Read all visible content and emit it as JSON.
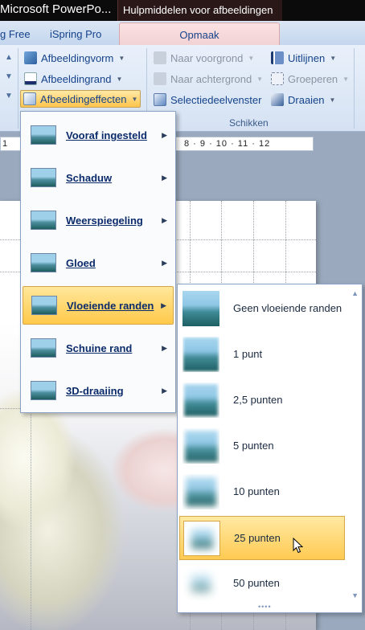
{
  "window": {
    "app_title": "Microsoft PowerPo...",
    "context_title": "Hulpmiddelen voor afbeeldingen"
  },
  "tabs": [
    {
      "label": "g Free"
    },
    {
      "label": "iSpring Pro"
    },
    {
      "label": "Opmaak",
      "active": true
    }
  ],
  "ribbon": {
    "picture_styles": [
      {
        "label": "Afbeeldingvorm",
        "icon": "shape-icon"
      },
      {
        "label": "Afbeeldingrand",
        "icon": "border-pen-icon"
      },
      {
        "label": "Afbeeldingeffecten",
        "icon": "effects-icon",
        "active": true
      }
    ],
    "arrange": [
      {
        "label": "Naar voorgrond",
        "icon": "bring-forward-icon",
        "disabled": true
      },
      {
        "label": "Naar achtergrond",
        "icon": "send-backward-icon",
        "disabled": true
      },
      {
        "label": "Selectiedeelvenster",
        "icon": "selection-pane-icon"
      },
      {
        "label": "Uitlijnen",
        "icon": "align-icon"
      },
      {
        "label": "Groeperen",
        "icon": "group-icon",
        "disabled": true
      },
      {
        "label": "Draaien",
        "icon": "rotate-icon"
      }
    ],
    "group_label": "Schikken"
  },
  "ruler": {
    "left_label": "1",
    "labels": "8 · 9 · 10 · 11 · 12"
  },
  "effects_menu": {
    "items": [
      {
        "label": "Vooraf ingesteld",
        "has_submenu": true
      },
      {
        "label": "Schaduw",
        "has_submenu": true
      },
      {
        "label": "Weerspiegeling",
        "has_submenu": true
      },
      {
        "label": "Gloed",
        "has_submenu": true
      },
      {
        "label": "Vloeiende randen",
        "has_submenu": true,
        "selected": true
      },
      {
        "label": "Schuine rand",
        "has_submenu": true
      },
      {
        "label": "3D-draaiing",
        "has_submenu": true
      }
    ]
  },
  "soft_edges_gallery": {
    "items": [
      {
        "label": "Geen vloeiende randen",
        "blur": 0
      },
      {
        "label": "1 punt",
        "blur": 1
      },
      {
        "label": "2,5 punten",
        "blur": 2.5
      },
      {
        "label": "5 punten",
        "blur": 5
      },
      {
        "label": "10 punten",
        "blur": 10
      },
      {
        "label": "25 punten",
        "blur": 25,
        "selected": true
      },
      {
        "label": "50 punten",
        "blur": 50
      }
    ]
  },
  "colors": {
    "accent_hover": "#ffc94a",
    "context_tab": "#f2d2d4",
    "ribbon_text": "#15428b"
  }
}
